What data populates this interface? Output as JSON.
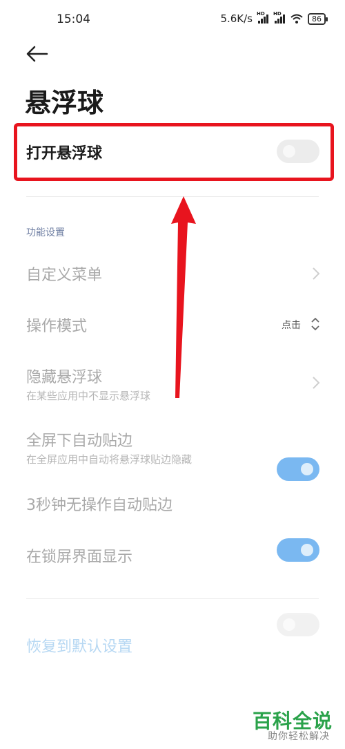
{
  "status_bar": {
    "time": "15:04",
    "net_speed": "5.6K/s",
    "signal_badge": "HD",
    "battery": "86"
  },
  "page": {
    "title": "悬浮球"
  },
  "main_toggle": {
    "label": "打开悬浮球",
    "state": "off"
  },
  "section": {
    "header": "功能设置"
  },
  "settings": {
    "custom_menu": {
      "label": "自定义菜单"
    },
    "operation_mode": {
      "label": "操作模式",
      "value": "点击"
    },
    "hide_ball": {
      "label": "隐藏悬浮球",
      "sub": "在某些应用中不显示悬浮球"
    },
    "fullscreen_edge": {
      "label": "全屏下自动贴边",
      "sub": "在全屏应用中自动将悬浮球贴边隐藏",
      "state": "on"
    },
    "idle_edge": {
      "label": "3秒钟无操作自动贴边",
      "state": "on"
    },
    "lockscreen": {
      "label": "在锁屏界面显示",
      "state": "off"
    }
  },
  "reset": {
    "label": "恢复到默认设置"
  },
  "watermark": {
    "title": "百科全说",
    "subtitle": "助你轻松解决"
  },
  "colors": {
    "annotation_red": "#e8141e",
    "toggle_on": "#5aa7ee",
    "watermark_green": "#2aa24a"
  }
}
